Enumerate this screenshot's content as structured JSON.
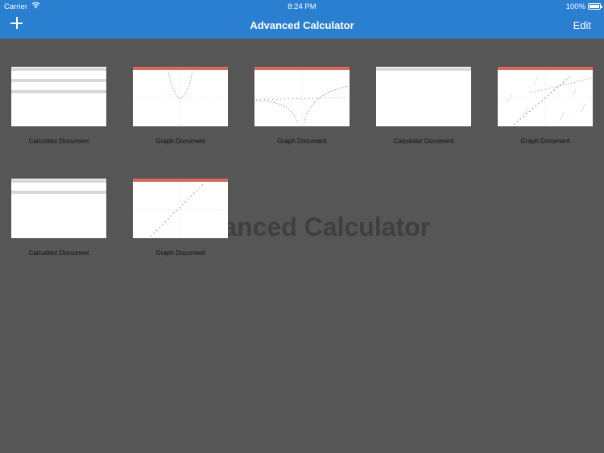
{
  "status_bar": {
    "carrier": "Carrier",
    "time": "8:24 PM",
    "battery": "100%"
  },
  "nav": {
    "title": "Advanced Calculator",
    "edit": "Edit"
  },
  "watermark": "Advanced Calculator",
  "documents": [
    {
      "label": "Calculator Document",
      "kind": "calculator"
    },
    {
      "label": "Graph Document",
      "kind": "graph"
    },
    {
      "label": "Graph Document",
      "kind": "graph"
    },
    {
      "label": "Calculator Document",
      "kind": "calculator"
    },
    {
      "label": "Graph Document",
      "kind": "graph"
    },
    {
      "label": "Calculator Document",
      "kind": "calculator"
    },
    {
      "label": "Graph Document",
      "kind": "graph"
    }
  ],
  "colors": {
    "accent": "#2a7fd0",
    "background": "#565656",
    "graph_header": "#d86a5c"
  }
}
